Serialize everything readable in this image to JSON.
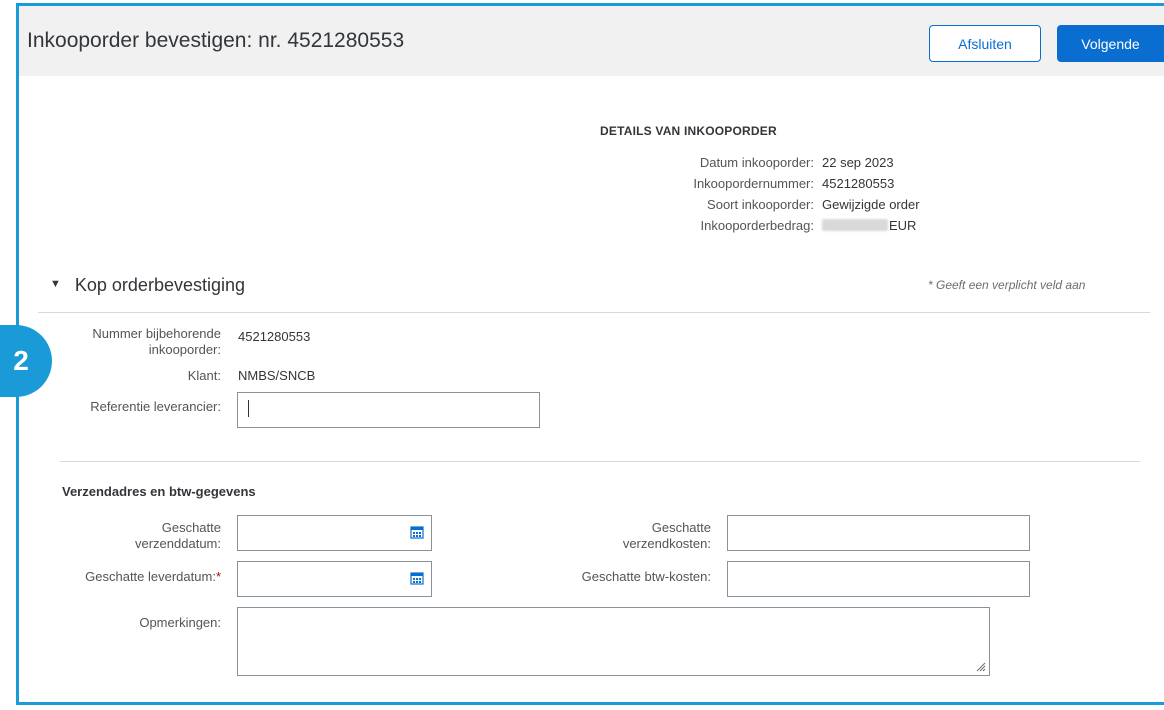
{
  "header": {
    "title": "Inkooporder bevestigen: nr. 4521280553",
    "close_label": "Afsluiten",
    "next_label": "Volgende"
  },
  "details": {
    "heading": "DETAILS VAN INKOOPORDER",
    "rows": [
      {
        "label": "Datum inkooporder:",
        "value": "22 sep 2023"
      },
      {
        "label": "Inkoopordernummer:",
        "value": "4521280553"
      },
      {
        "label": "Soort inkooporder:",
        "value": "Gewijzigde order"
      },
      {
        "label": "Inkooporderbedrag:",
        "value": "EUR"
      }
    ]
  },
  "section": {
    "title": "Kop orderbevestiging",
    "required_note": "*  Geeft een verplicht veld aan",
    "badge": "2",
    "po_number_label_1": "Nummer bijbehorende",
    "po_number_label_2": "inkooporder:",
    "po_number_value": "4521280553",
    "customer_label": "Klant:",
    "customer_value": "NMBS/SNCB",
    "supplier_ref_label": "Referentie leverancier:",
    "supplier_ref_value": ""
  },
  "shipping": {
    "heading": "Verzendadres en btw-gegevens",
    "ship_date_label_1": "Geschatte",
    "ship_date_label_2": "verzenddatum:",
    "delivery_date_label": "Geschatte leverdatum:",
    "required_star": "*",
    "ship_cost_label_1": "Geschatte",
    "ship_cost_label_2": "verzendkosten:",
    "vat_label": "Geschatte btw-kosten:",
    "comments_label": "Opmerkingen:"
  },
  "colors": {
    "accent": "#1a9bd7",
    "primary_button": "#0a6ed1"
  },
  "icons": [
    "calendar-icon",
    "collapse-triangle-icon",
    "resize-grip-icon"
  ]
}
